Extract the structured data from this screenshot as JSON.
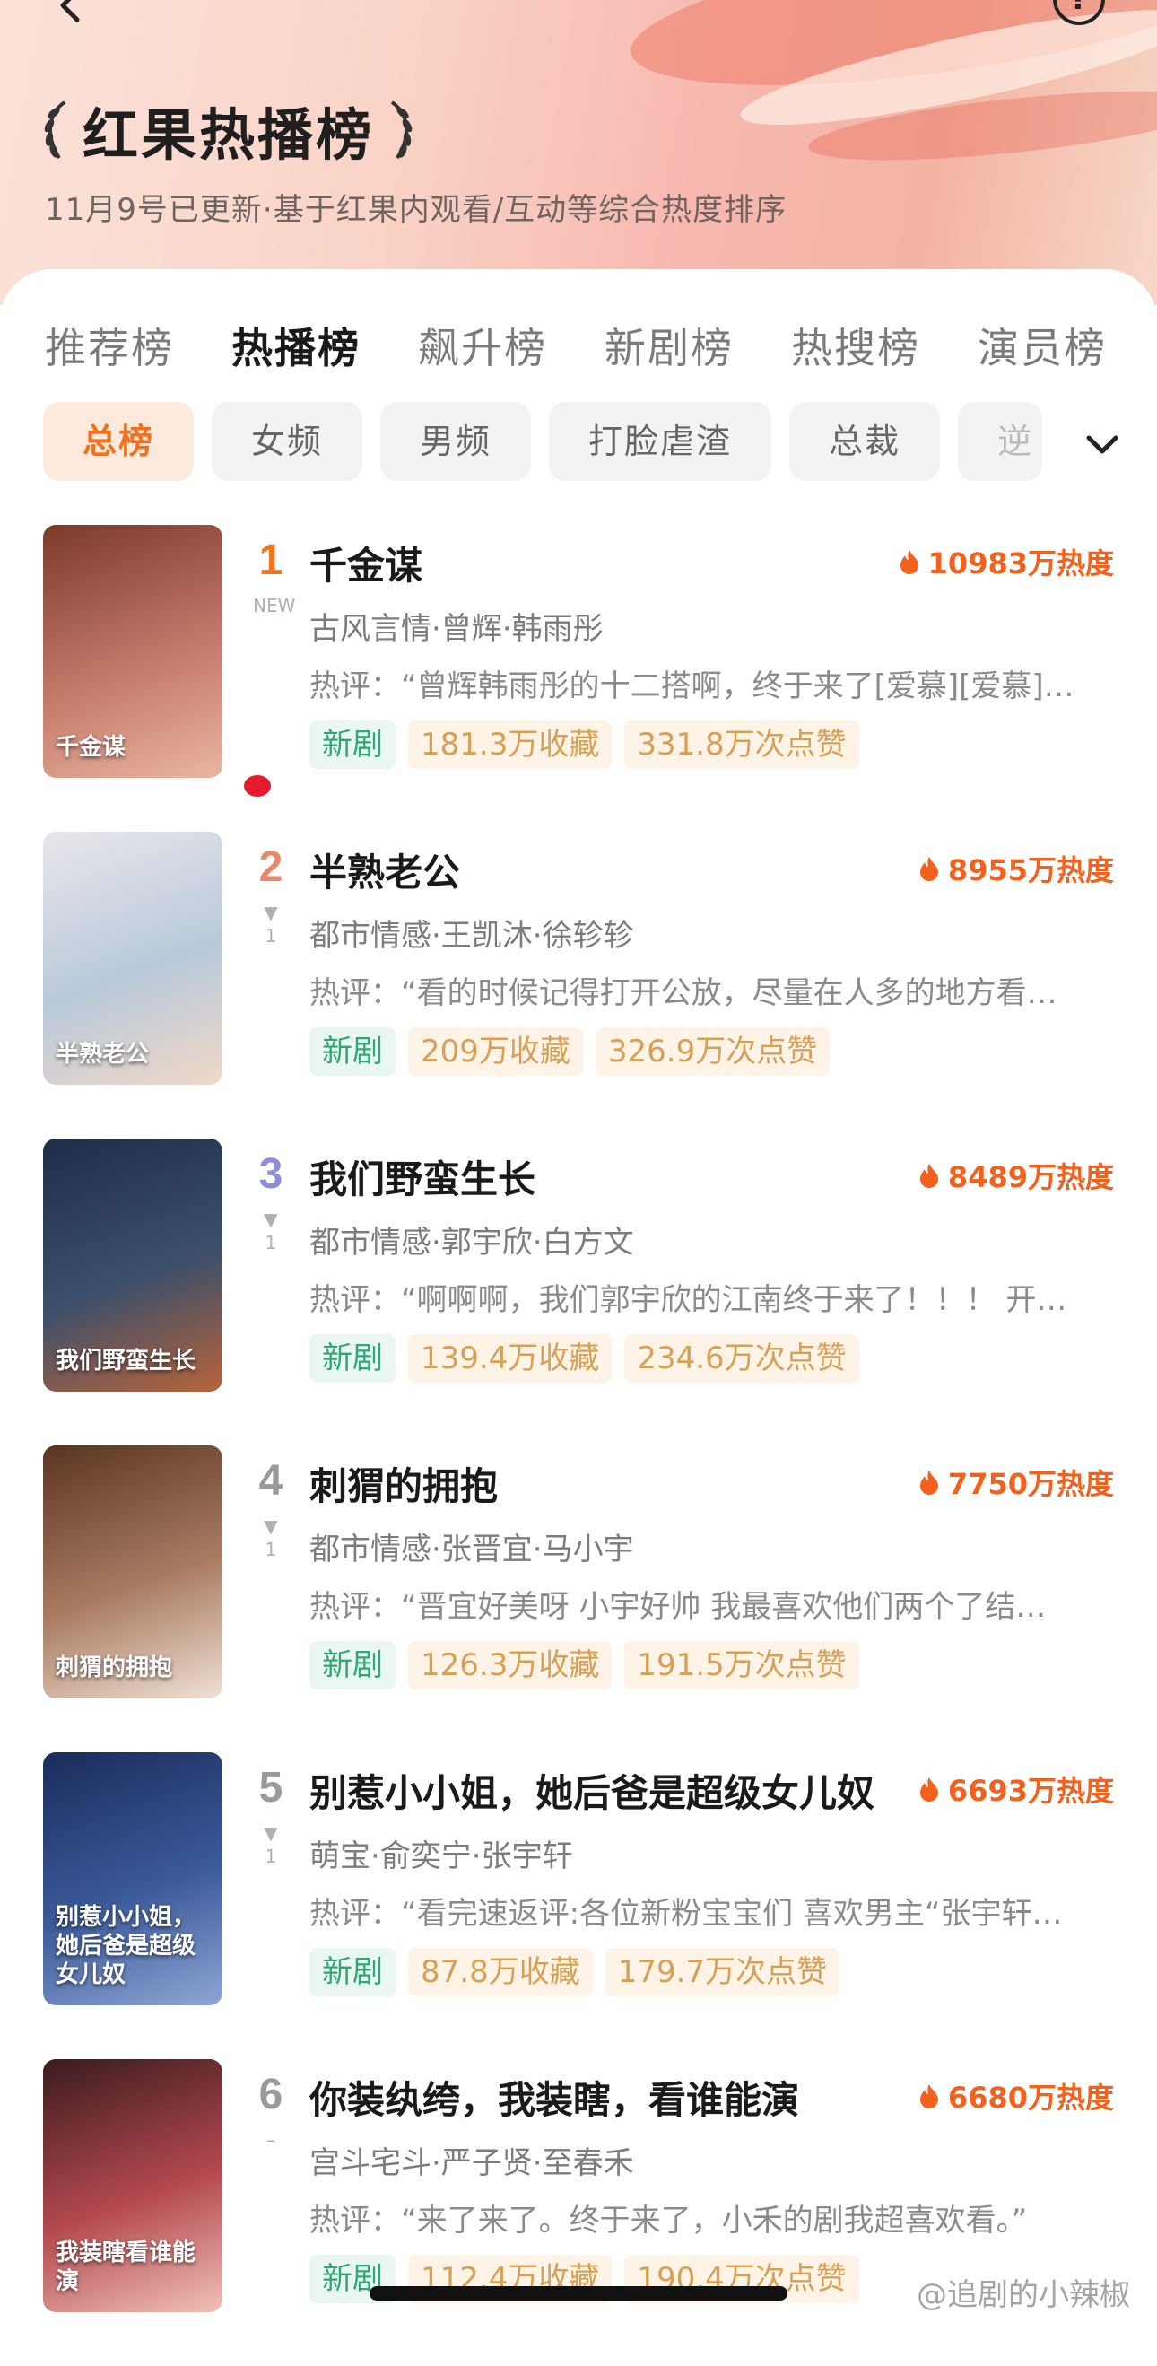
{
  "header": {
    "title": "红果热播榜",
    "subtitle": "11月9号已更新·基于红果内观看/互动等综合热度排序",
    "back_icon": "chevron-left-icon",
    "help_icon": "question-circle-icon",
    "help_glyph": "?"
  },
  "tabs": [
    {
      "label": "推荐榜",
      "active": false
    },
    {
      "label": "热播榜",
      "active": true
    },
    {
      "label": "飙升榜",
      "active": false
    },
    {
      "label": "新剧榜",
      "active": false
    },
    {
      "label": "热搜榜",
      "active": false
    },
    {
      "label": "演员榜",
      "active": false
    }
  ],
  "chips": [
    {
      "label": "总榜",
      "active": true
    },
    {
      "label": "女频",
      "active": false
    },
    {
      "label": "男频",
      "active": false
    },
    {
      "label": "打脸虐渣",
      "active": false
    },
    {
      "label": "总裁",
      "active": false
    },
    {
      "label": "逆",
      "active": false
    }
  ],
  "items": [
    {
      "rank": "1",
      "trend": "NEW",
      "rank_color": "#f2761d",
      "name": "千金谋",
      "heat": "10983万热度",
      "genre": "古风言情·曾辉·韩雨彤",
      "comment": "热评：“曾辉韩雨彤的十二搭啊，终于来了[爱慕][爱慕]…",
      "tag_new": "新剧",
      "favorites": "181.3万收藏",
      "likes": "331.8万次点赞",
      "poster_text": "千金谋",
      "poster_colors": [
        "#7a3a2a",
        "#c4786a",
        "#e9b6a0"
      ]
    },
    {
      "rank": "2",
      "trend": "▼\n1",
      "rank_color": "#e58b6b",
      "name": "半熟老公",
      "heat": "8955万热度",
      "genre": "都市情感·王凯沐·徐轸轸",
      "comment": "热评：“看的时候记得打开公放，尽量在人多的地方看…",
      "tag_new": "新剧",
      "favorites": "209万收藏",
      "likes": "326.9万次点赞",
      "poster_text": "半熟老公",
      "poster_colors": [
        "#e8e6ea",
        "#b9c9da",
        "#efd8c8"
      ]
    },
    {
      "rank": "3",
      "trend": "▼\n1",
      "rank_color": "#8d8ed8",
      "name": "我们野蛮生长",
      "heat": "8489万热度",
      "genre": "都市情感·郭宇欣·白方文",
      "comment": "热评：“啊啊啊，我们郭宇欣的江南终于来了！！！ 开…",
      "tag_new": "新剧",
      "favorites": "139.4万收藏",
      "likes": "234.6万次点赞",
      "poster_text": "我们野蛮生长",
      "poster_colors": [
        "#1d2d4a",
        "#3d4f6a",
        "#b7643a"
      ]
    },
    {
      "rank": "4",
      "trend": "▼\n1",
      "rank_color": "#9a9a9a",
      "name": "刺猬的拥抱",
      "heat": "7750万热度",
      "genre": "都市情感·张晋宜·马小宇",
      "comment": "热评：“晋宜好美呀 小宇好帅 我最喜欢他们两个了结…",
      "tag_new": "新剧",
      "favorites": "126.3万收藏",
      "likes": "191.5万次点赞",
      "poster_text": "刺猬的拥抱",
      "poster_colors": [
        "#5a3422",
        "#a97c62",
        "#efe0d4"
      ]
    },
    {
      "rank": "5",
      "trend": "▼\n1",
      "rank_color": "#9a9a9a",
      "name": "别惹小小姐，她后爸是超级女儿奴",
      "heat": "6693万热度",
      "genre": "萌宝·俞奕宁·张宇轩",
      "comment": "热评：“看完速返评:各位新粉宝宝们 喜欢男主“张宇轩…",
      "tag_new": "新剧",
      "favorites": "87.8万收藏",
      "likes": "179.7万次点赞",
      "poster_text": "别惹小小姐，她后爸是超级女儿奴",
      "poster_colors": [
        "#1a2c5a",
        "#3b5a9a",
        "#8fa6d4"
      ]
    },
    {
      "rank": "6",
      "trend": "–",
      "rank_color": "#9a9a9a",
      "name": "你装纨绔，我装瞎，看谁能演",
      "heat": "6680万热度",
      "genre": "宫斗宅斗·严子贤·至春禾",
      "comment": "热评：“来了来了。终于来了，小禾的剧我超喜欢看。”",
      "tag_new": "新剧",
      "favorites": "112.4万收藏",
      "likes": "190.4万次点赞",
      "poster_text": "我装瞎看谁能演",
      "poster_colors": [
        "#3a1b1e",
        "#b4494f",
        "#f0c1b7"
      ]
    }
  ],
  "chips_toggle_icon": "chevron-down-icon",
  "heat_icon": "flame-icon",
  "watermark": "@追剧的小辣椒"
}
